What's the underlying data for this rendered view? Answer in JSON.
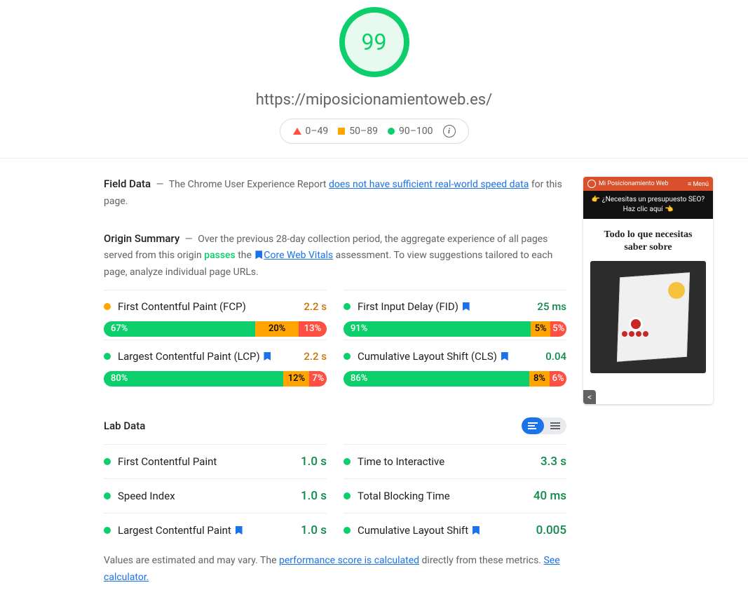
{
  "score": "99",
  "tested_url": "https://miposicionamientoweb.es/",
  "legend": {
    "low": "0–49",
    "mid": "50–89",
    "high": "90–100"
  },
  "field_data": {
    "heading": "Field Data",
    "pre": "The Chrome User Experience Report ",
    "link": "does not have sufficient real-world speed data",
    "post": " for this page."
  },
  "origin": {
    "heading": "Origin Summary",
    "t1": "Over the previous 28-day collection period, the aggregate experience of all pages served from this origin ",
    "passes": "passes",
    "t2": " the ",
    "cwv": "Core Web Vitals",
    "t3": " assessment. To view suggestions tailored to each page, analyze individual page URLs."
  },
  "origin_metrics": [
    {
      "name": "First Contentful Paint (FCP)",
      "value": "2.2 s",
      "vclass": "val-orange",
      "dot": "orange",
      "bm": false,
      "dist": [
        67,
        20,
        13
      ]
    },
    {
      "name": "First Input Delay (FID)",
      "value": "25 ms",
      "vclass": "val-green",
      "dot": "green",
      "bm": true,
      "dist": [
        91,
        5,
        5
      ]
    },
    {
      "name": "Largest Contentful Paint (LCP)",
      "value": "2.2 s",
      "vclass": "val-orange",
      "dot": "green",
      "bm": true,
      "dist": [
        80,
        12,
        7
      ]
    },
    {
      "name": "Cumulative Layout Shift (CLS)",
      "value": "0.04",
      "vclass": "val-green",
      "dot": "green",
      "bm": true,
      "dist": [
        86,
        8,
        6
      ]
    }
  ],
  "lab": {
    "heading": "Lab Data",
    "metrics": [
      {
        "name": "First Contentful Paint",
        "value": "1.0 s",
        "bm": false
      },
      {
        "name": "Time to Interactive",
        "value": "3.3 s",
        "bm": false
      },
      {
        "name": "Speed Index",
        "value": "1.0 s",
        "bm": false
      },
      {
        "name": "Total Blocking Time",
        "value": "40 ms",
        "bm": false
      },
      {
        "name": "Largest Contentful Paint",
        "value": "1.0 s",
        "bm": true
      },
      {
        "name": "Cumulative Layout Shift",
        "value": "0.005",
        "bm": true
      }
    ],
    "foot1": "Values are estimated and may vary. The ",
    "footlink1": "performance score is calculated",
    "foot2": " directly from these metrics. ",
    "footlink2": "See calculator."
  },
  "preview": {
    "brand": "Mi Posicionamiento Web",
    "menu": "Menú",
    "banner": "👉 ¿Necesitas un presupuesto SEO? Haz clic aquí 👈",
    "title_l1": "Todo lo que necesitas",
    "title_l2": "saber sobre"
  }
}
